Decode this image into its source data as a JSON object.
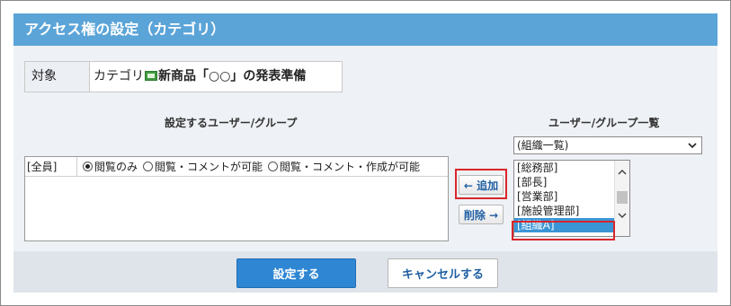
{
  "header": {
    "title": "アクセス権の設定（カテゴリ）"
  },
  "target": {
    "label": "対象",
    "prefix": "カテゴリ",
    "name": "新商品「○○」の発表準備"
  },
  "assigned": {
    "heading": "設定するユーザー/グループ",
    "rows": [
      {
        "name": "[全員]",
        "options": [
          "閲覧のみ",
          "閲覧・コメントが可能",
          "閲覧・コメント・作成が可能"
        ],
        "selected_index": 0
      }
    ]
  },
  "buttons": {
    "add": "← 追加",
    "remove": "削除 →",
    "submit": "設定する",
    "cancel": "キャンセルする"
  },
  "picker": {
    "heading": "ユーザー/グループ一覧",
    "select_value": "(組織一覧)",
    "items": [
      "[総務部]",
      "[部長]",
      "[営業部]",
      "[施設管理部]",
      "[組織A]"
    ],
    "selected_index": 4
  },
  "colors": {
    "header": "#5ba4d8",
    "accent": "#2f86d3",
    "highlight": "#d9262b"
  }
}
